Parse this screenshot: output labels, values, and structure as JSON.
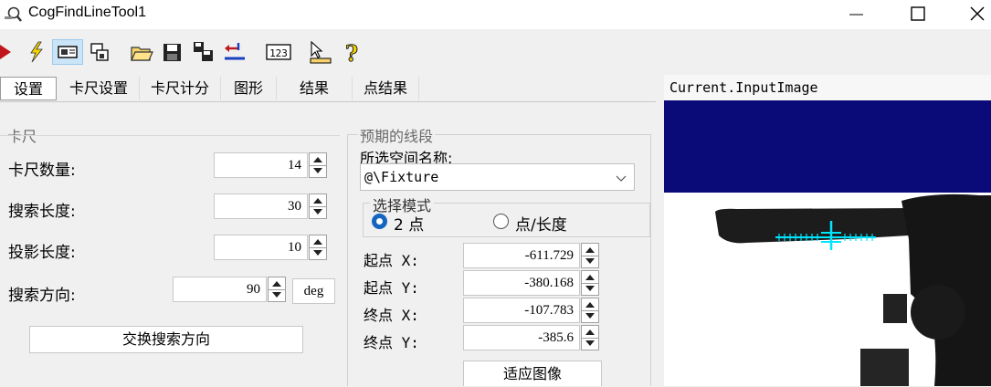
{
  "window": {
    "title": "CogFindLineTool1"
  },
  "tabs": [
    "设置",
    "卡尺设置",
    "卡尺计分",
    "图形",
    "结果",
    "点结果"
  ],
  "caliper": {
    "group_title": "卡尺",
    "count_label": "卡尺数量:",
    "count_value": "14",
    "search_length_label": "搜索长度:",
    "search_length_value": "30",
    "projection_length_label": "投影长度:",
    "projection_length_value": "10",
    "search_direction_label": "搜索方向:",
    "search_direction_value": "90",
    "unit_button": "deg",
    "swap_button": "交换搜索方向"
  },
  "expected_segment": {
    "group_title": "预期的线段",
    "space_name_label": "所选空间名称:",
    "space_name_value": "@\\Fixture",
    "mode_group_title": "选择模式",
    "mode_option_1": "2 点",
    "mode_option_2": "点/长度",
    "start_x_label": "起点 X:",
    "start_x_value": "-611.729",
    "start_y_label": "起点 Y:",
    "start_y_value": "-380.168",
    "end_x_label": "终点 X:",
    "end_x_value": "-107.783",
    "end_y_label": "终点 Y:",
    "end_y_value": "-385.6",
    "fit_button": "适应图像"
  },
  "image_panel": {
    "title": "Current.InputImage"
  },
  "colors": {
    "navy": "#0a0a78",
    "line": "#00e5ff",
    "radio_selected": "#1565c0"
  }
}
